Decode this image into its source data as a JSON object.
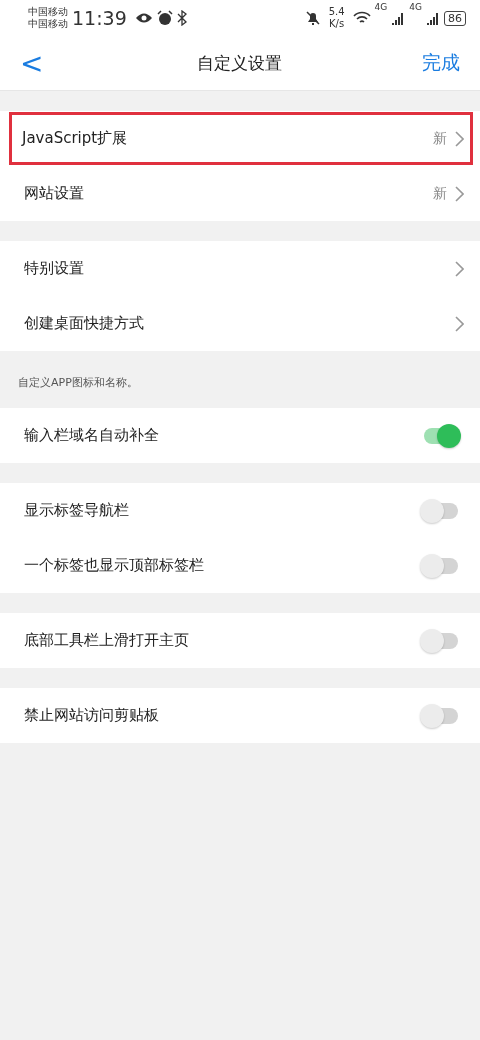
{
  "status_bar": {
    "carriers": [
      "中国移动",
      "中国移动"
    ],
    "time": "11:39",
    "speed": [
      "5.4",
      "K/s"
    ],
    "network_labels": [
      "4G",
      "4G"
    ],
    "battery": "86"
  },
  "nav": {
    "back": "<",
    "title": "自定义设置",
    "done": "完成"
  },
  "groups": [
    {
      "rows": [
        {
          "kind": "link",
          "label": "JavaScript扩展",
          "badge": "新",
          "highlighted": true
        },
        {
          "kind": "link",
          "label": "网站设置",
          "badge": "新",
          "highlighted": false
        }
      ]
    },
    {
      "rows": [
        {
          "kind": "link",
          "label": "特别设置",
          "highlighted": false
        },
        {
          "kind": "link",
          "label": "创建桌面快捷方式",
          "highlighted": false
        }
      ],
      "note": "自定义APP图标和名称。"
    },
    {
      "rows": [
        {
          "kind": "toggle",
          "label": "输入栏域名自动补全",
          "on": true
        }
      ]
    },
    {
      "rows": [
        {
          "kind": "toggle",
          "label": "显示标签导航栏",
          "on": false
        },
        {
          "kind": "toggle",
          "label": "一个标签也显示顶部标签栏",
          "on": false
        }
      ]
    },
    {
      "rows": [
        {
          "kind": "toggle",
          "label": "底部工具栏上滑打开主页",
          "on": false
        }
      ]
    },
    {
      "rows": [
        {
          "kind": "toggle",
          "label": "禁止网站访问剪贴板",
          "on": false
        }
      ]
    }
  ]
}
